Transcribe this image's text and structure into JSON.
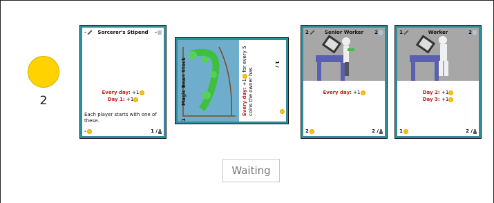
{
  "player": {
    "coins": "2"
  },
  "cards": [
    {
      "name": "Sorcerer's Stipend",
      "top_left": "-",
      "top_right": "-",
      "effects": [
        {
          "trigger": "Every day:",
          "text": "+1"
        },
        {
          "trigger": "Day 1:",
          "text": "+1"
        }
      ],
      "description": "Each player starts with one of these.",
      "cost": "-",
      "count": "1 /"
    },
    {
      "name": "Magic Bean Stock",
      "top_left": "1",
      "top_right": "1 /",
      "effect_trigger": "Every day:",
      "effect_text": "+1",
      "effect_rest": "for every 5 coins the owner has",
      "cost": "1"
    },
    {
      "name": "Senior Worker",
      "top_left": "2",
      "top_right": "2",
      "effects": [
        {
          "trigger": "Every day:",
          "text": "+1"
        }
      ],
      "cost": "2",
      "count": "2 /"
    },
    {
      "name": "Worker",
      "top_left": "1",
      "top_right": "2",
      "effects": [
        {
          "trigger": "Day 2:",
          "text": "+1"
        },
        {
          "trigger": "Day 3:",
          "text": "+1"
        }
      ],
      "cost": "1",
      "count": "2 /"
    }
  ],
  "status_button": "Waiting",
  "colors": {
    "coin": "#ffd200",
    "card_border": "#2f8c9c",
    "effect_red": "#c0201a"
  },
  "icons": [
    "sword-icon",
    "shield-icon",
    "coin-icon",
    "person-icon"
  ]
}
